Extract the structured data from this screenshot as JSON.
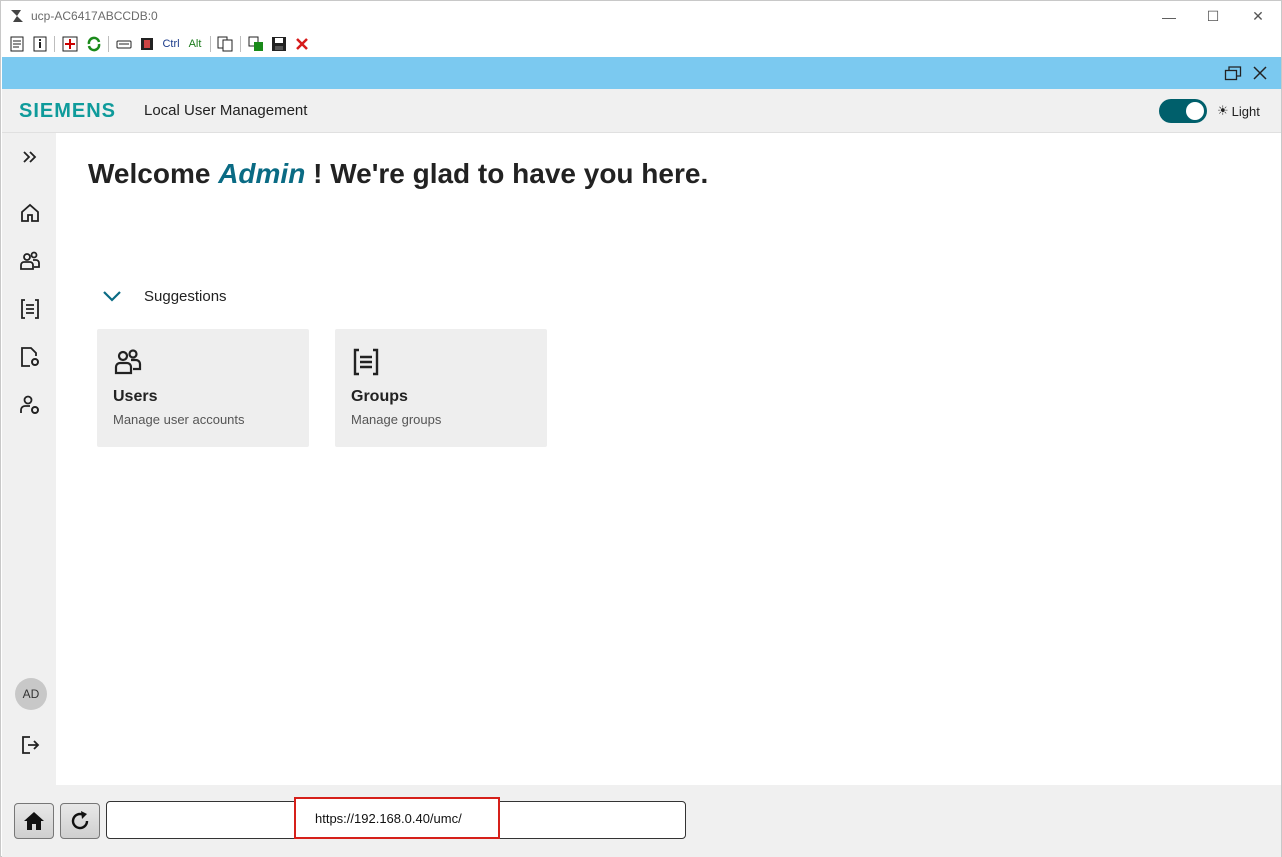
{
  "window": {
    "title": "ucp-AC6417ABCCDB:0",
    "minimize_glyph": "—",
    "maximize_glyph": "☐",
    "close_glyph": "✕"
  },
  "toolbar": {
    "items": [
      "properties-icon",
      "info-icon",
      "fullscreen-icon",
      "refresh-icon",
      "keyboard-icon",
      "film-icon",
      "Ctrl",
      "Alt",
      "copy-icon",
      "transfer-icon",
      "save-icon",
      "disconnect-icon"
    ],
    "ctrl_label": "Ctrl",
    "alt_label": "Alt"
  },
  "header": {
    "logo": "SIEMENS",
    "app_name": "Local User Management",
    "theme_label": "Light",
    "theme_glyph": "☀",
    "toggle_on": true
  },
  "sidebar": {
    "items": [
      "expand-icon",
      "home-icon",
      "users-icon",
      "groups-icon",
      "document-settings-icon",
      "user-settings-icon"
    ],
    "avatar": "AD",
    "logout": "logout-icon"
  },
  "main": {
    "welcome_prefix": "Welcome",
    "welcome_name": "Admin",
    "welcome_suffix": "! We're glad to have you here.",
    "suggestions_label": "Suggestions",
    "cards": [
      {
        "title": "Users",
        "subtitle": "Manage user accounts",
        "icon": "users-icon"
      },
      {
        "title": "Groups",
        "subtitle": "Manage groups",
        "icon": "groups-icon"
      }
    ]
  },
  "bottom": {
    "url": "https://192.168.0.40/umc/",
    "home_icon": "home-icon",
    "reload_icon": "reload-icon"
  },
  "colors": {
    "accent": "#0f9b9b",
    "toggle": "#005f6b",
    "name": "#0a6b84",
    "top_bar": "#7bc9f0",
    "highlight": "#d6201a"
  }
}
